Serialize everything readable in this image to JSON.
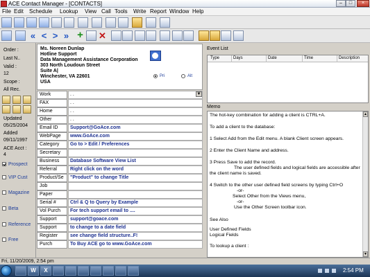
{
  "window": {
    "title": "ACE Contact Manager - [CONTACTS]",
    "controls": [
      "–",
      "□",
      "×"
    ]
  },
  "menu": [
    "File",
    "Edit",
    "Schedule",
    "Lookup",
    "View",
    "Call",
    "Tools",
    "Write",
    "Report",
    "Window",
    "Help"
  ],
  "toolbar1": {
    "icons": [
      "record-icon",
      "list-icon",
      "list-icon",
      "grid-icon",
      "edit-icon",
      "book-icon",
      "wrench-icon",
      "globe-icon",
      "info-icon",
      "envelope-icon",
      "folder-icon",
      "user-icon",
      "chart-icon"
    ]
  },
  "toolbar2": {
    "icons": [
      "save-icon",
      "copy-icon",
      "first-icon",
      "previous-icon",
      "next-icon",
      "last-icon",
      "add-icon",
      "edit-icon",
      "delete-icon",
      "search-icon",
      "find-icon",
      "link-icon",
      "sort-icon",
      "print-icon",
      "phone-icon",
      "calendar-icon",
      "letter-icon",
      "open-folder-icon",
      "export-icon",
      "import-icon",
      "note-icon"
    ],
    "glyphs": {
      "first": "«",
      "previous": "<",
      "next": ">",
      "last": "»",
      "add": "+",
      "delete": "✕"
    }
  },
  "left_panel": {
    "order_label": "Order :",
    "lastn_label": "Last N..",
    "valid_label": "Valid :",
    "valid_value": "12",
    "scope_label": "Scope :",
    "scope_value": "All Rec.",
    "updated_label": "Updated",
    "updated_value": "05/25/2004",
    "added_label": "Added",
    "added_value": "09/11/1997",
    "acct_label": "ACE Acct :",
    "acct_value": "4",
    "checks": [
      {
        "label": "Prospect",
        "checked": true
      },
      {
        "label": "VIP Cust",
        "checked": false
      },
      {
        "label": "Magazine",
        "checked": false
      },
      {
        "label": "Beta",
        "checked": false
      },
      {
        "label": "Reference",
        "checked": false
      },
      {
        "label": "Free",
        "checked": false
      }
    ]
  },
  "address": {
    "lines": [
      "Ms. Noreen Dunlap",
      "Hotline Support",
      "Data Management Assistance Corporation",
      "303 North Loudoun Street",
      "Suite A|",
      "Winchester, VA 22601",
      "USA"
    ],
    "radio_primary": "Pri",
    "radio_alt": "Alt"
  },
  "fields": [
    {
      "label": "Work",
      "value": ".  .",
      "dropdown": true,
      "plain": true
    },
    {
      "label": "FAX",
      "value": ".  .",
      "dropdown": false,
      "plain": true
    },
    {
      "label": "Home",
      "value": ".  .",
      "dropdown": false,
      "plain": true
    },
    {
      "label": "Other",
      "value": ".  .",
      "dropdown": false,
      "plain": true
    },
    {
      "label": "Email ID",
      "value": "Support@GoAce.com",
      "dropdown": false,
      "plain": false
    },
    {
      "label": "WebPage",
      "value": "www.GoAce.com",
      "dropdown": false,
      "plain": false
    },
    {
      "label": "Category",
      "value": "Go to >  Edit / Preferences",
      "dropdown": false,
      "plain": false
    },
    {
      "label": "Secretary",
      "value": "",
      "dropdown": false,
      "plain": false
    },
    {
      "label": "Business",
      "value": "Database Software   View List",
      "dropdown": false,
      "plain": false
    },
    {
      "label": "Referral",
      "value": "Right click on the word",
      "dropdown": false,
      "plain": false
    },
    {
      "label": "Product/Se",
      "value": "\"Product\" to change Title",
      "dropdown": false,
      "plain": false
    },
    {
      "label": "Job",
      "value": "",
      "dropdown": false,
      "plain": false
    },
    {
      "label": "Paper",
      "value": "",
      "dropdown": false,
      "plain": false
    },
    {
      "label": "Serial #",
      "value": "Ctrl & Q to Query by Example",
      "dropdown": false,
      "plain": false
    },
    {
      "label": "Vol Purch",
      "value": "For tech support email to ....",
      "dropdown": false,
      "plain": false
    },
    {
      "label": "Support",
      "value": "support@goace.com",
      "dropdown": false,
      "plain": false
    },
    {
      "label": "Support",
      "value": "to change to a date field",
      "dropdown": false,
      "plain": false
    },
    {
      "label": "Register",
      "value": "see change field structure..F!",
      "dropdown": false,
      "plain": false
    },
    {
      "label": "Purch",
      "value": "To Buy ACE go to www.GoAce.com",
      "dropdown": false,
      "plain": false
    }
  ],
  "event_list": {
    "title": "Event List",
    "columns": [
      "Type",
      "Days",
      "Date",
      "Time",
      "Description"
    ]
  },
  "memo": {
    "title": "Memo",
    "lines": [
      "The hot-key combination for adding a client is CTRL+A.",
      "To add a client to the database:",
      "1            Select Add from the Edit menu. A blank Client screen appears.",
      "2            Enter the Client Name and address.",
      "3            Press Save to add the record.",
      "The user defined fields and logical fields are accessible after",
      "the client name is saved.",
      "4            Switch to the other user defined field screens by typing Ctrl+O",
      "-or-",
      "Select Other from the Views menu,",
      "-or-",
      "Use the Other Screen toolbar icon.",
      "See Also",
      "User Defined Fields",
      "Logical Fields",
      "To lookup a client :"
    ]
  },
  "statusbar": {
    "text": "Fri, 11/20/2009, 2:54 pm"
  },
  "taskbar": {
    "tasks": [
      "",
      "W",
      "X",
      "",
      "",
      "",
      "",
      "",
      "",
      ""
    ],
    "clock": "2:54 PM"
  }
}
